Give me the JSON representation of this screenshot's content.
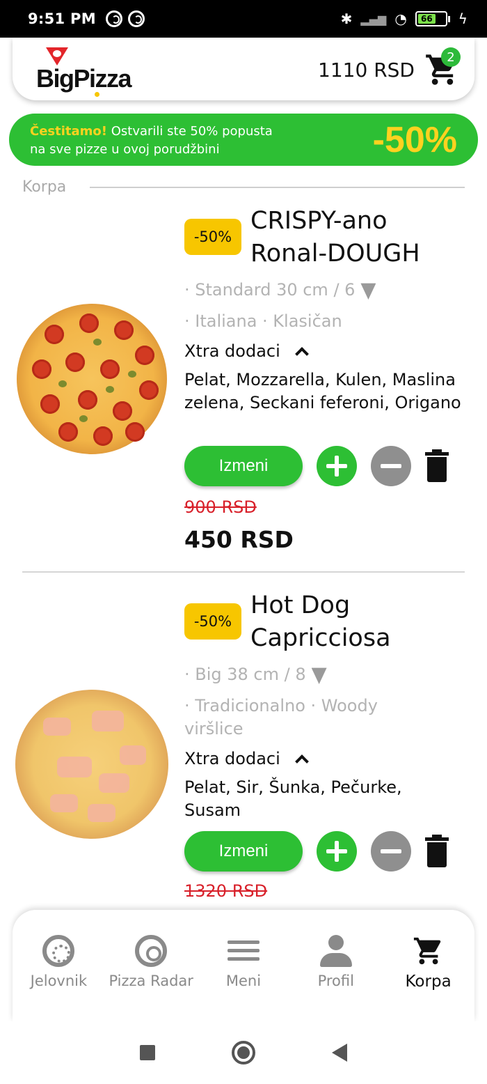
{
  "status_bar": {
    "time": "9:51 PM",
    "battery": "66"
  },
  "header": {
    "logo_text": "BigPizza",
    "cart_total": "1110 RSD",
    "cart_count": "2"
  },
  "promo": {
    "highlight": "Čestitamo!",
    "message_1": " Ostvarili ste 50% popusta",
    "message_2": "na sve pizze u ovoj porudžbini",
    "discount": "-50%"
  },
  "section_label": "Korpa",
  "items": [
    {
      "badge": "-50%",
      "title_line1": "CRISPY-ano",
      "title_line2": "Ronal-DOUGH",
      "size": "· Standard 30 cm / 6",
      "style": "· Italiana · Klasičan",
      "extras_label": "Xtra dodaci",
      "extras": "Pelat, Mozzarella, Kulen, Maslina zelena, Seckani feferoni, Origano",
      "edit_label": "Izmeni",
      "old_price": "900 RSD",
      "new_price": "450 RSD"
    },
    {
      "badge": "-50%",
      "title_line1": "Hot Dog",
      "title_line2": "Capricciosa",
      "size": "· Big 38 cm / 8",
      "style": "· Tradicionalno · Woody viršlice",
      "extras_label": "Xtra dodaci",
      "extras": "Pelat, Sir, Šunka, Pečurke, Susam",
      "edit_label": "Izmeni",
      "old_price": "1320 RSD"
    }
  ],
  "bottom_nav": [
    {
      "label": "Jelovnik",
      "icon": "pizza-menu-icon"
    },
    {
      "label": "Pizza Radar",
      "icon": "radar-icon"
    },
    {
      "label": "Meni",
      "icon": "hamburger-menu-icon"
    },
    {
      "label": "Profil",
      "icon": "person-icon"
    },
    {
      "label": "Korpa",
      "icon": "cart-icon",
      "active": true
    }
  ],
  "colors": {
    "green": "#2dbf34",
    "yellow": "#f7c600",
    "red": "#d8202a"
  }
}
